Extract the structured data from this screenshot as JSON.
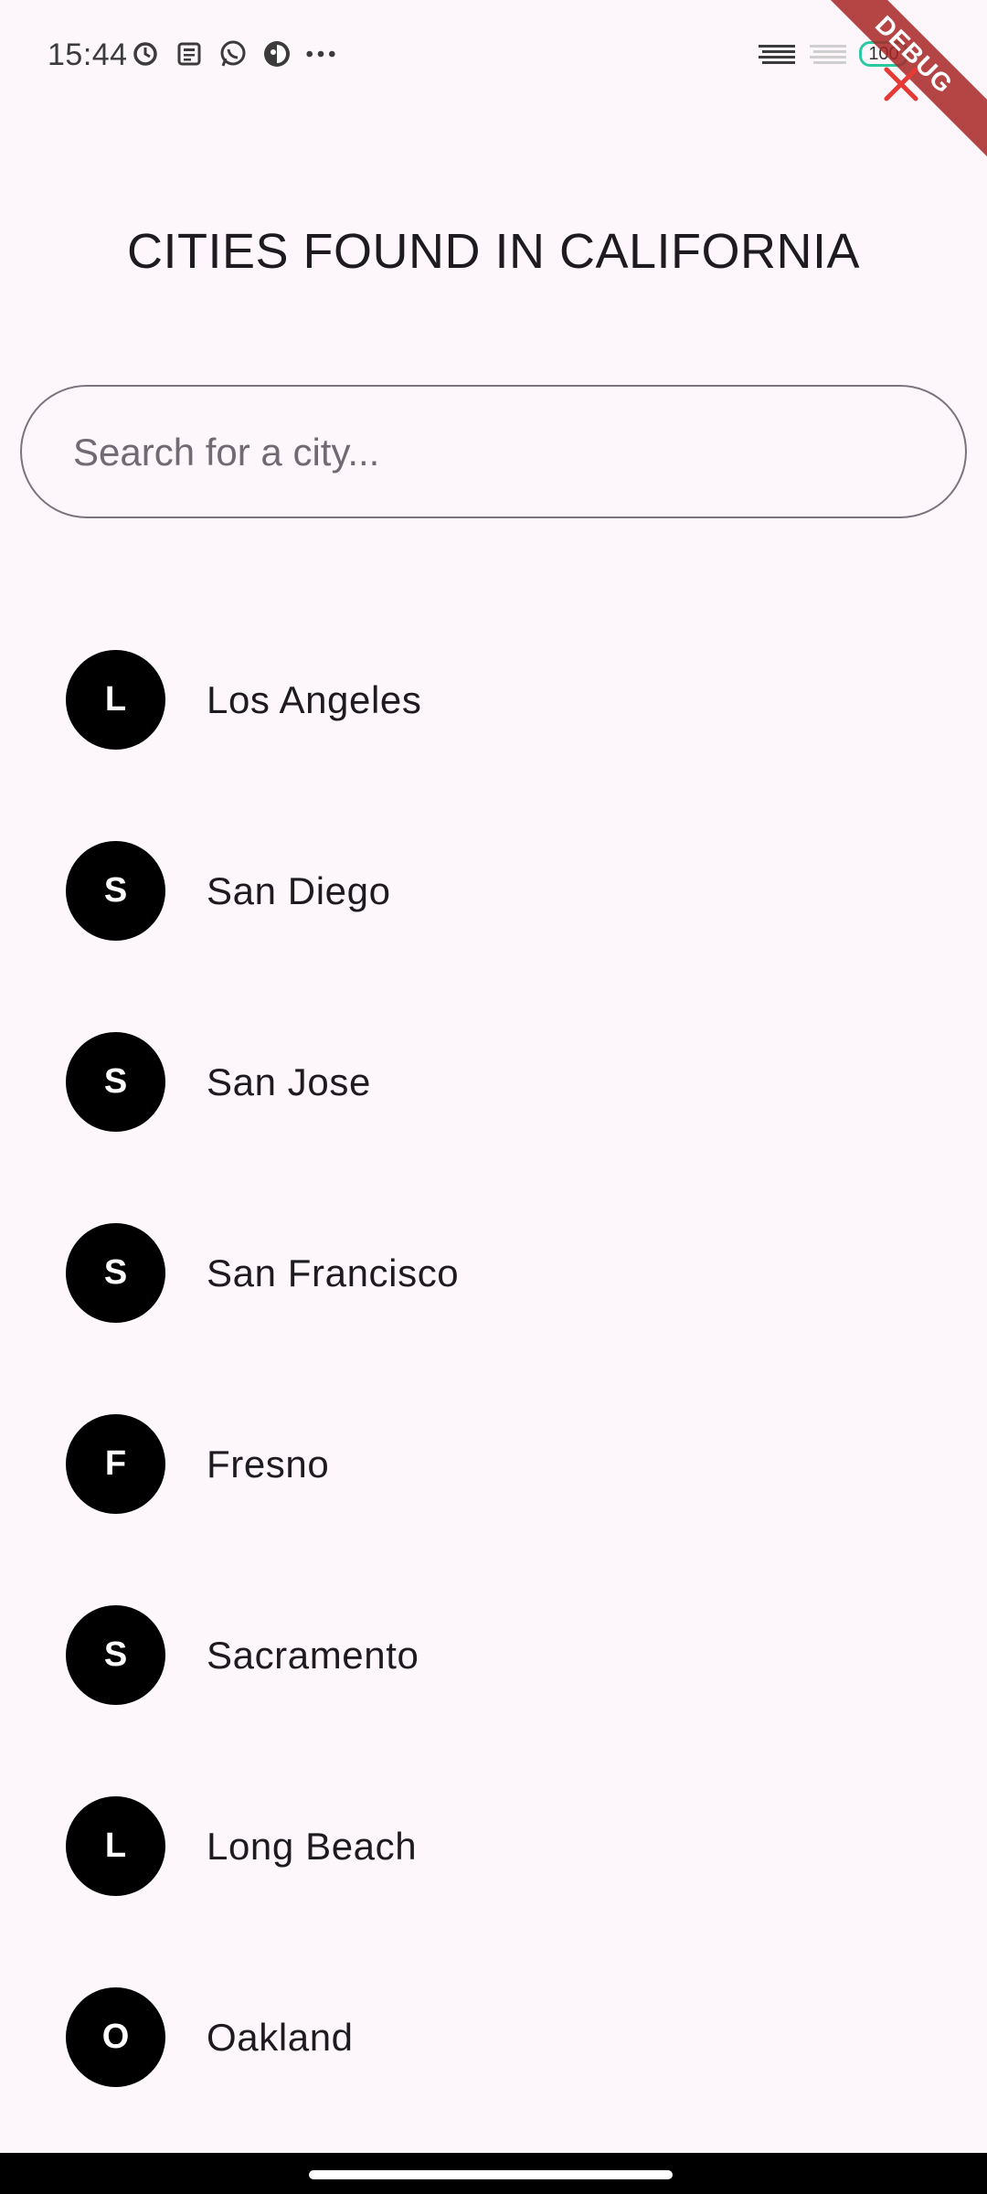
{
  "status_bar": {
    "time": "15:44",
    "left_icons": [
      "alarm-icon",
      "news-icon",
      "whatsapp-icon",
      "app-icon",
      "more-dots-icon"
    ],
    "right_icons": [
      "signal-icon",
      "signal-2-icon",
      "battery-icon"
    ],
    "battery_level": "100"
  },
  "debug_banner": "DEBUG",
  "header": {
    "title": "CITIES FOUND IN CALIFORNIA"
  },
  "search": {
    "placeholder": "Search for a city...",
    "value": ""
  },
  "cities": [
    {
      "initial": "L",
      "name": "Los Angeles"
    },
    {
      "initial": "S",
      "name": "San Diego"
    },
    {
      "initial": "S",
      "name": "San Jose"
    },
    {
      "initial": "S",
      "name": "San Francisco"
    },
    {
      "initial": "F",
      "name": "Fresno"
    },
    {
      "initial": "S",
      "name": "Sacramento"
    },
    {
      "initial": "L",
      "name": "Long Beach"
    },
    {
      "initial": "O",
      "name": "Oakland"
    }
  ],
  "colors": {
    "background": "#fdf7fb",
    "avatar": "#000000",
    "close_icon": "#e53935",
    "debug_banner": "#a82424",
    "battery_outline": "#2bc9a0"
  }
}
